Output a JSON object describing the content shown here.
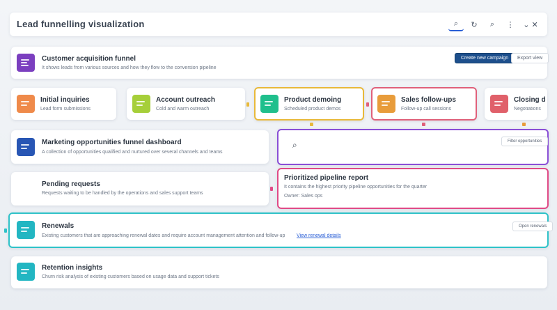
{
  "header": {
    "title": "Lead funnelling visualization",
    "icons": [
      "search-icon",
      "refresh-icon",
      "zoom-icon",
      "more-icon",
      "window-controls-icon"
    ],
    "icon_glyphs": [
      "⌕",
      "↻",
      "⌕",
      "⋮",
      "⌄ ✕"
    ]
  },
  "colors": {
    "purple": "#7b3fbf",
    "orange": "#ef8a4a",
    "lime": "#a6cf3a",
    "green": "#1fbf8c",
    "amber": "#e89c3b",
    "red": "#e0606a",
    "navy": "#2856b4",
    "teal": "#22b6c2",
    "yellow_border": "#e8b93a",
    "pink_border": "#e0607a",
    "violet_border": "#8a4fd6",
    "magenta_border": "#e04a86",
    "cyan_border": "#2ec2c8"
  },
  "row1": {
    "title": "Customer acquisition funnel",
    "subtitle": "It shows leads from various sources and how they flow to the conversion pipeline",
    "primary_button": "Create new campaign",
    "secondary_button": "Export view"
  },
  "stages": [
    {
      "title": "Initial inquiries",
      "subtitle": "Lead form submissions"
    },
    {
      "title": "Account outreach",
      "subtitle": "Cold and warm outreach"
    },
    {
      "title": "Product demoing",
      "subtitle": "Scheduled product demos"
    },
    {
      "title": "Sales follow-ups",
      "subtitle": "Follow-up call sessions"
    },
    {
      "title": "Closing deals",
      "subtitle": "Negotiations"
    }
  ],
  "row3_left": {
    "title": "Marketing opportunities funnel dashboard",
    "subtitle": "A collection of opportunities qualified and nurtured over several channels and teams"
  },
  "row3_right": {
    "search_icon": "⌕",
    "filter_label": "Filter opportunities"
  },
  "row4_left": {
    "title": "Pending requests",
    "subtitle": "Requests waiting to be handled by the operations and sales support teams"
  },
  "row4_right": {
    "title": "Prioritized pipeline report",
    "subtitle": "It contains the highest priority pipeline opportunities for the quarter",
    "meta": "Owner: Sales ops"
  },
  "row5": {
    "title": "Renewals",
    "subtitle": "Existing customers that are approaching renewal dates and require account management attention and follow-up",
    "link": "View renewal details",
    "button": "Open renewals"
  },
  "row6": {
    "title": "Retention insights",
    "subtitle": "Churn risk analysis of existing customers based on usage data and support tickets"
  }
}
